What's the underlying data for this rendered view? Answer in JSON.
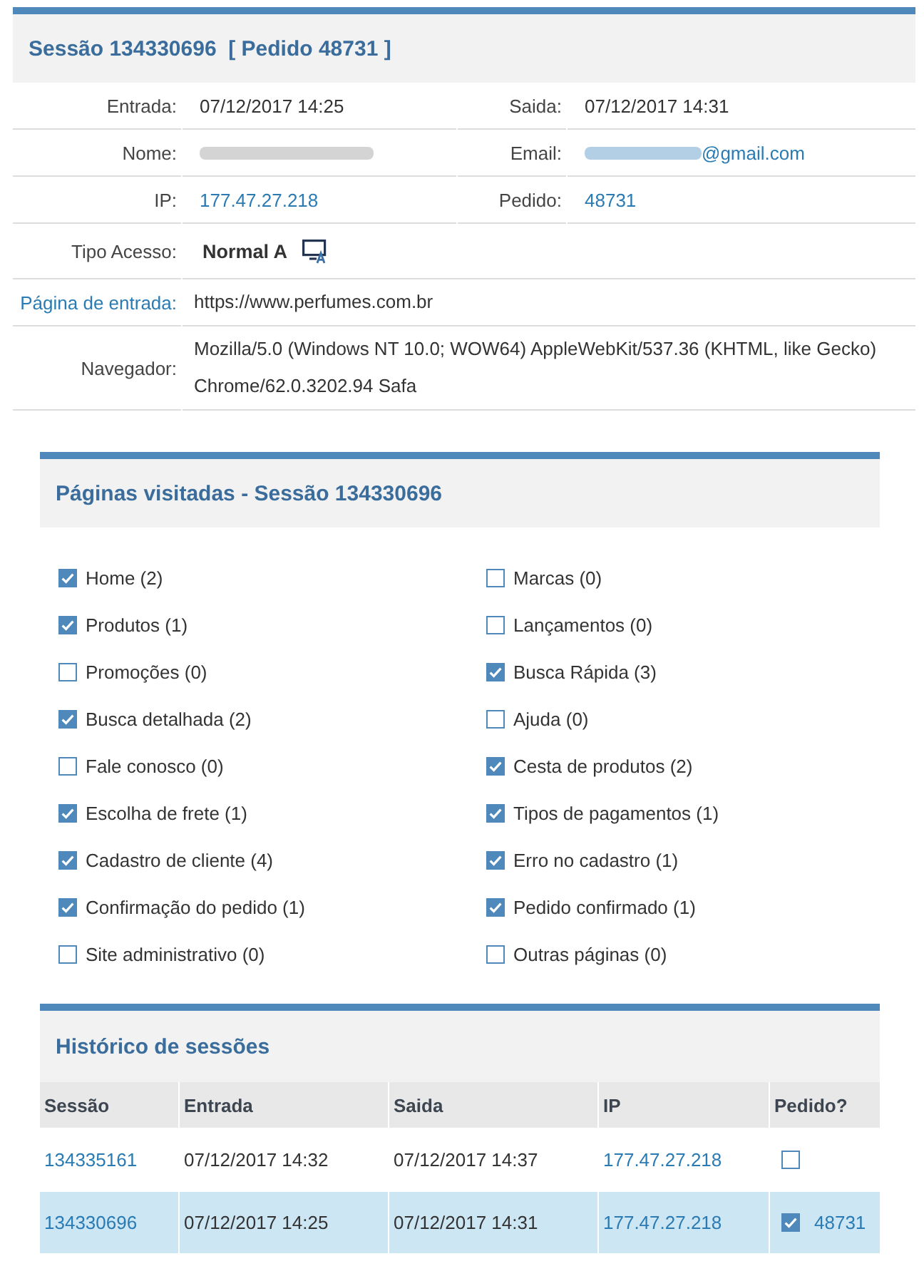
{
  "session": {
    "title": "Sessão 134330696  [ Pedido 48731 ]",
    "details": [
      {
        "kind": "pair",
        "fields": [
          {
            "label": "Entrada:",
            "value": "07/12/2017 14:25",
            "kind": "text",
            "redacted": false
          },
          {
            "label": "Saida:",
            "value": "07/12/2017 14:31",
            "kind": "text",
            "redacted": false
          }
        ]
      },
      {
        "kind": "pair",
        "fields": [
          {
            "label": "Nome:",
            "kind": "text",
            "redacted": true
          },
          {
            "label": "Email:",
            "value": "@gmail.com",
            "kind": "link",
            "redacted": true
          }
        ]
      },
      {
        "kind": "pair",
        "fields": [
          {
            "label": "IP:",
            "value": "177.47.27.218",
            "kind": "link",
            "redacted": false
          },
          {
            "label": "Pedido:",
            "value": "48731",
            "kind": "link",
            "redacted": false
          }
        ]
      },
      {
        "kind": "access",
        "label": "Tipo Acesso:",
        "value": "Normal A"
      },
      {
        "kind": "wide",
        "label": "Página de entrada:",
        "label_link": true,
        "value": "https://www.perfumes.com.br"
      },
      {
        "kind": "wide",
        "label": "Navegador:",
        "label_link": false,
        "value": "Mozilla/5.0 (Windows NT 10.0; WOW64) AppleWebKit/537.36 (KHTML, like Gecko) Chrome/62.0.3202.94 Safa"
      }
    ]
  },
  "pages": {
    "title": "Páginas visitadas - Sessão 134330696",
    "items": [
      {
        "label": "Home (2)",
        "checked": true
      },
      {
        "label": "Marcas (0)",
        "checked": false
      },
      {
        "label": "Produtos (1)",
        "checked": true
      },
      {
        "label": "Lançamentos (0)",
        "checked": false
      },
      {
        "label": "Promoções (0)",
        "checked": false
      },
      {
        "label": "Busca Rápida (3)",
        "checked": true
      },
      {
        "label": "Busca detalhada (2)",
        "checked": true
      },
      {
        "label": "Ajuda (0)",
        "checked": false
      },
      {
        "label": "Fale conosco (0)",
        "checked": false
      },
      {
        "label": "Cesta de produtos (2)",
        "checked": true
      },
      {
        "label": "Escolha de frete (1)",
        "checked": true
      },
      {
        "label": "Tipos de pagamentos (1)",
        "checked": true
      },
      {
        "label": "Cadastro de cliente (4)",
        "checked": true
      },
      {
        "label": "Erro no cadastro (1)",
        "checked": true
      },
      {
        "label": "Confirmação do pedido (1)",
        "checked": true
      },
      {
        "label": "Pedido confirmado (1)",
        "checked": true
      },
      {
        "label": "Site administrativo (0)",
        "checked": false
      },
      {
        "label": "Outras páginas (0)",
        "checked": false
      }
    ]
  },
  "history": {
    "title": "Histórico de sessões",
    "columns": [
      "Sessão",
      "Entrada",
      "Saida",
      "IP",
      "Pedido?"
    ],
    "rows": [
      {
        "selected": false,
        "session": "134335161",
        "entrada": "07/12/2017 14:32",
        "saida": "07/12/2017 14:37",
        "ip": "177.47.27.218",
        "ordered": false
      },
      {
        "selected": true,
        "session": "134330696",
        "entrada": "07/12/2017 14:25",
        "saida": "07/12/2017 14:31",
        "ip": "177.47.27.218",
        "ordered": true,
        "order": "48731"
      }
    ]
  }
}
